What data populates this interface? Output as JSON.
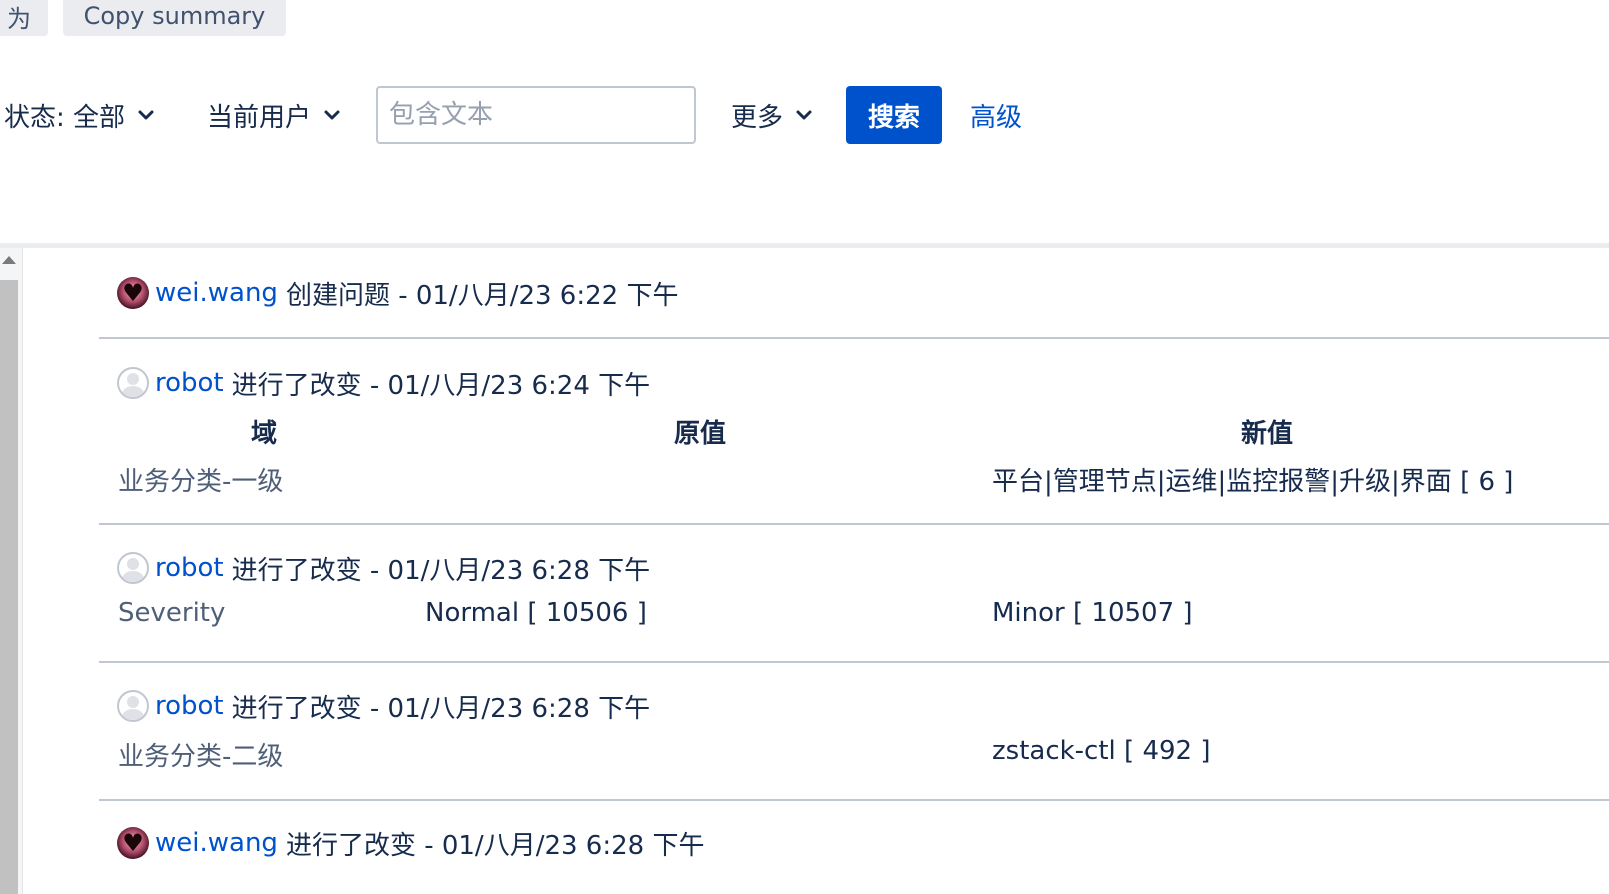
{
  "top_buttons": {
    "partial_label": "为",
    "copy_summary": "Copy summary"
  },
  "filters": {
    "status": "状态: 全部",
    "assignee": "当前用户",
    "text_placeholder": "包含文本",
    "more": "更多",
    "search": "搜索",
    "advanced": "高级"
  },
  "history": {
    "headers": {
      "field": "域",
      "old": "原值",
      "new": "新值"
    },
    "actions": [
      {
        "user": "wei.wang",
        "action": "创建问题 - 01/八月/23 6:22 下午",
        "avatar": "heart-avatar"
      },
      {
        "user": "robot",
        "action": "进行了改变 - 01/八月/23 6:24 下午",
        "avatar": "default-avatar",
        "field": "业务分类-一级",
        "old": "",
        "new": "平台|管理节点|运维|监控报警|升级|界面 [ 6 ]"
      },
      {
        "user": "robot",
        "action": "进行了改变 - 01/八月/23 6:28 下午",
        "avatar": "default-avatar",
        "field": "Severity",
        "old": "Normal [ 10506 ]",
        "new": "Minor [ 10507 ]"
      },
      {
        "user": "robot",
        "action": "进行了改变 - 01/八月/23 6:28 下午",
        "avatar": "default-avatar",
        "field": "业务分类-二级",
        "old": "",
        "new": "zstack-ctl [ 492 ]"
      },
      {
        "user": "wei.wang",
        "action": "进行了改变 - 01/八月/23 6:28 下午",
        "avatar": "heart-avatar"
      }
    ]
  }
}
